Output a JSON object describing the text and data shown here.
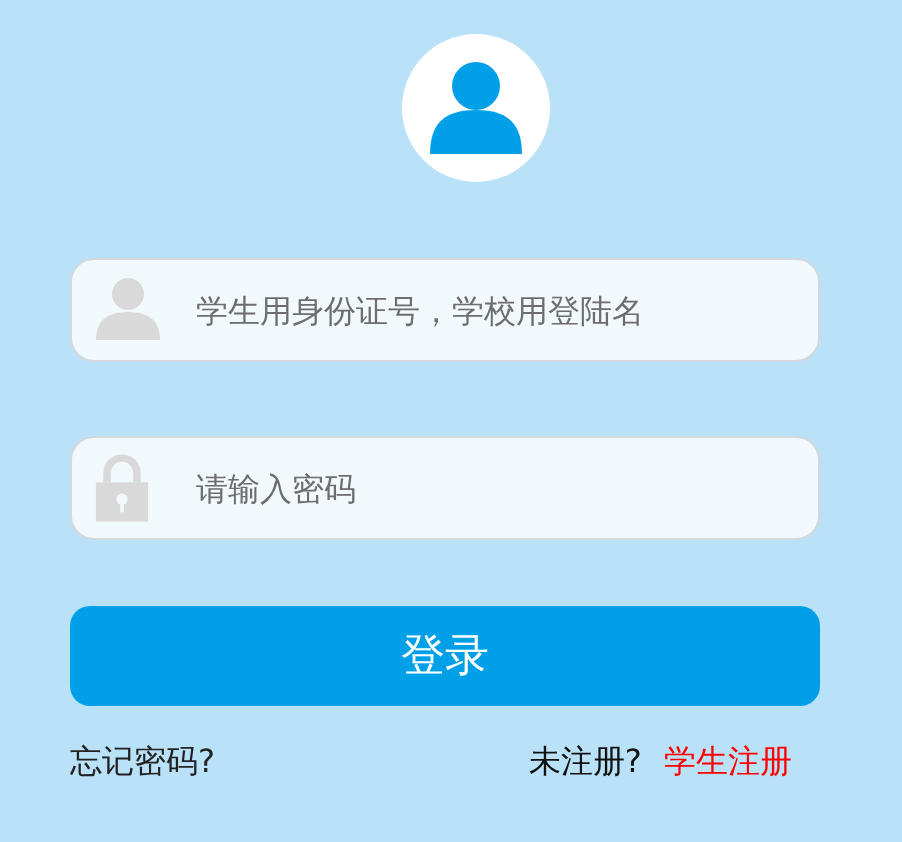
{
  "fields": [
    {
      "kind": "user",
      "placeholder": "学生用身份证号，学校用登陆名"
    },
    {
      "kind": "password",
      "placeholder": "请输入密码"
    }
  ],
  "login_button": "登录",
  "forgot_link": "忘记密码?",
  "register_prompt": "未注册?",
  "register_link": "学生注册"
}
